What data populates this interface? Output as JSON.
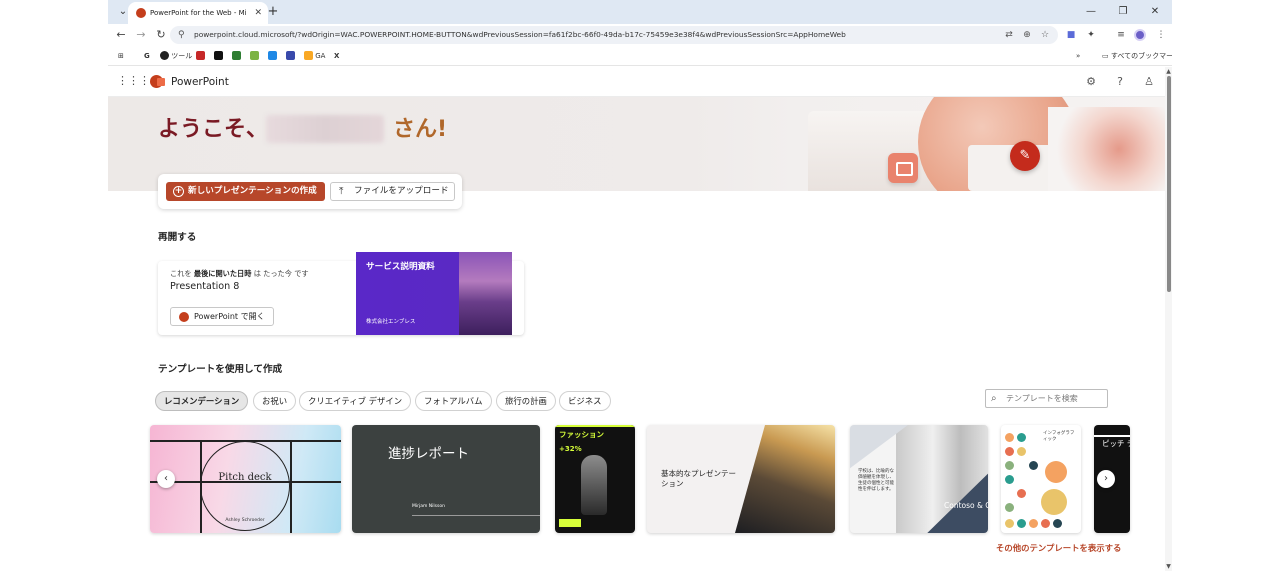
{
  "browser": {
    "tab_title": "PowerPoint for the Web - Micro",
    "tab_close": "✕",
    "new_tab": "+",
    "tab_menu": "⌄",
    "win_min": "—",
    "win_max": "❐",
    "win_close": "✕",
    "url": "powerpoint.cloud.microsoft/?wdOrigin=WAC.POWERPOINT.HOME-BUTTON&wdPreviousSession=fa61f2bc-66f0-49da-b17c-75459e3e38f4&wdPreviousSessionSrc=AppHomeWeb",
    "icons": [
      "back-icon",
      "forward-icon",
      "reload-icon",
      "site-settings-icon",
      "translate-icon",
      "zoom-icon",
      "star-icon",
      "extensions-icon",
      "media-icon",
      "profile-icon",
      "menu-icon"
    ],
    "bookmarks": {
      "apps_icon": "⊞",
      "google": "G",
      "tools": "ツール",
      "ga": "GA",
      "x": "X",
      "all_bookmarks": "すべてのブックマーク",
      "more": "»"
    }
  },
  "app": {
    "name": "PowerPoint",
    "waffle": "⋮⋮⋮",
    "settings_icon": "⚙",
    "help_icon": "?",
    "account_icon": "♙"
  },
  "hero": {
    "greeting_prefix": "ようこそ、",
    "greeting_suffix": "さん!",
    "pencil": "✎"
  },
  "actions": {
    "new_presentation": "新しいプレゼンテーションの作成",
    "upload": "ファイルをアップロード",
    "upload_icon": "⤒"
  },
  "resume": {
    "heading": "再開する",
    "meta_prefix": "これを",
    "meta_bold": "最後に開いた日時",
    "meta_suffix": "は たった今 です",
    "file_name": "Presentation 8",
    "open_button": "PowerPoint で開く",
    "thumb_title": "サービス説明資料",
    "thumb_company": "株式会社エンブレス"
  },
  "templates": {
    "heading": "テンプレートを使用して作成",
    "chips": [
      "レコメンデーション",
      "お祝い",
      "クリエイティブ デザイン",
      "フォトアルバム",
      "旅行の計画",
      "ビジネス"
    ],
    "search_placeholder": "テンプレートを検索",
    "search_icon": "⌕",
    "prev": "‹",
    "next": "›",
    "more_link": "その他のテンプレートを表示する",
    "items": {
      "t1_title": "Pitch deck",
      "t1_author": "Ashley Schroeder",
      "t2_title": "進捗レポート",
      "t2_author": "Mirjam Nilsson",
      "t3_title": "ファッション",
      "t3_pct": "+32%",
      "t4_title": "基本的なプレゼンテーション",
      "t5_title": "Contoso & Contoso",
      "t5_body": "学校は、比喩的な価値観を体現し、生徒の個性と可能性を伸ばします。",
      "t6_title": "インフォグラフィック",
      "t7_title": "ピッチ デ"
    }
  },
  "colors": {
    "accent": "#b7472a",
    "greeting": "#7a1a24",
    "greeting_suffix": "#b0672a",
    "resume_thumb": "#5a28c8"
  }
}
